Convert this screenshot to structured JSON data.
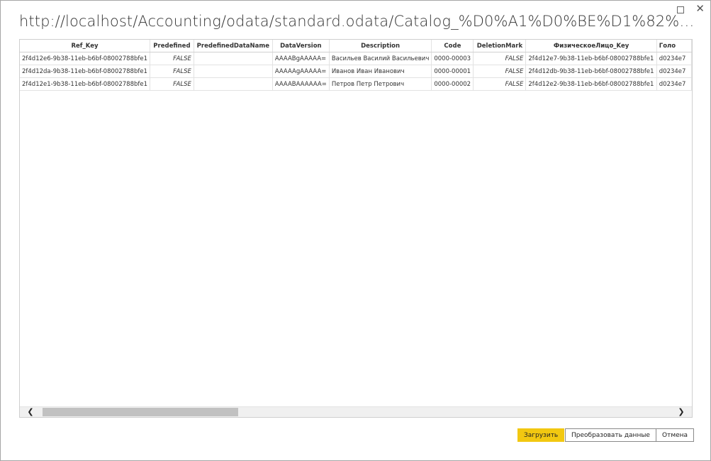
{
  "window": {
    "title": "http://localhost/Accounting/odata/standard.odata/Catalog_%D0%A1%D0%BE%D1%82%D1%80%D1%83%D0..."
  },
  "table": {
    "columns": [
      "Ref_Key",
      "Predefined",
      "PredefinedDataName",
      "DataVersion",
      "Description",
      "Code",
      "DeletionMark",
      "ФизическоеЛицо_Key",
      "Голо"
    ],
    "rows": [
      [
        "2f4d12e6-9b38-11eb-b6bf-08002788bfe1",
        "FALSE",
        "",
        "AAAABgAAAAA=",
        "Васильев Василий Васильевич",
        "0000-00003",
        "FALSE",
        "2f4d12e7-9b38-11eb-b6bf-08002788bfe1",
        "d0234e7"
      ],
      [
        "2f4d12da-9b38-11eb-b6bf-08002788bfe1",
        "FALSE",
        "",
        "AAAAAgAAAAA=",
        "Иванов Иван Иванович",
        "0000-00001",
        "FALSE",
        "2f4d12db-9b38-11eb-b6bf-08002788bfe1",
        "d0234e7"
      ],
      [
        "2f4d12e1-9b38-11eb-b6bf-08002788bfe1",
        "FALSE",
        "",
        "AAAABAAAAAA=",
        "Петров Петр Петрович",
        "0000-00002",
        "FALSE",
        "2f4d12e2-9b38-11eb-b6bf-08002788bfe1",
        "d0234e7"
      ]
    ]
  },
  "scrollbar": {
    "position_fraction": 0.0,
    "visible_fraction": 0.3
  },
  "buttons": {
    "load": "Загрузить",
    "transform": "Преобразовать данные",
    "cancel": "Отмена"
  },
  "icons": {
    "maximize": "□",
    "close": "✕",
    "scroll_left": "❮",
    "scroll_right": "❯"
  },
  "colors": {
    "primary_button": "#f2c811"
  }
}
